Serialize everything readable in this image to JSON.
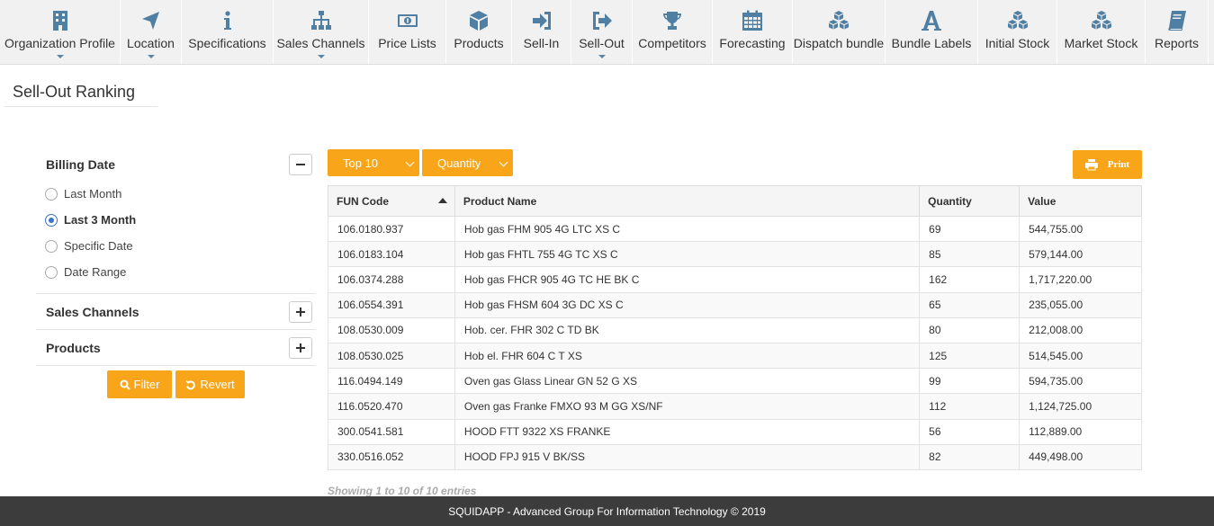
{
  "nav": {
    "items": [
      {
        "label": "Organization Profile",
        "icon": "building-icon",
        "has_dropdown": true
      },
      {
        "label": "Location",
        "icon": "location-arrow-icon",
        "has_dropdown": true
      },
      {
        "label": "Specifications",
        "icon": "info-icon",
        "has_dropdown": false
      },
      {
        "label": "Sales Channels",
        "icon": "sitemap-icon",
        "has_dropdown": true
      },
      {
        "label": "Price Lists",
        "icon": "money-icon",
        "has_dropdown": false
      },
      {
        "label": "Products",
        "icon": "cube-icon",
        "has_dropdown": false
      },
      {
        "label": "Sell-In",
        "icon": "sign-in-icon",
        "has_dropdown": false
      },
      {
        "label": "Sell-Out",
        "icon": "sign-out-icon",
        "has_dropdown": true
      },
      {
        "label": "Competitors",
        "icon": "trophy-icon",
        "has_dropdown": false
      },
      {
        "label": "Forecasting",
        "icon": "calendar-icon",
        "has_dropdown": false
      },
      {
        "label": "Dispatch bundle",
        "icon": "cubes-icon",
        "has_dropdown": false
      },
      {
        "label": "Bundle Labels",
        "icon": "font-icon",
        "has_dropdown": false
      },
      {
        "label": "Initial Stock",
        "icon": "cubes-icon",
        "has_dropdown": false
      },
      {
        "label": "Market Stock",
        "icon": "cubes-icon",
        "has_dropdown": false
      },
      {
        "label": "Reports",
        "icon": "book-icon",
        "has_dropdown": false
      }
    ]
  },
  "page": {
    "title": "Sell-Out Ranking"
  },
  "filters": {
    "billing_date": {
      "title": "Billing Date",
      "options": [
        "Last Month",
        "Last 3 Month",
        "Specific Date",
        "Date Range"
      ],
      "selected": "Last 3 Month"
    },
    "sales_channels": {
      "title": "Sales Channels"
    },
    "products": {
      "title": "Products"
    },
    "filter_label": "Filter",
    "revert_label": "Revert"
  },
  "toolbar": {
    "top_selected": "Top 10",
    "metric_selected": "Quantity",
    "print_label": "Print"
  },
  "table": {
    "columns": [
      "FUN Code",
      "Product Name",
      "Quantity",
      "Value"
    ],
    "sort_column": "FUN Code",
    "rows": [
      [
        "106.0180.937",
        "Hob gas FHM 905 4G LTC XS C",
        "69",
        "544,755.00"
      ],
      [
        "106.0183.104",
        "Hob gas FHTL 755 4G TC XS C",
        "85",
        "579,144.00"
      ],
      [
        "106.0374.288",
        "Hob gas FHCR 905 4G TC HE BK C",
        "162",
        "1,717,220.00"
      ],
      [
        "106.0554.391",
        "Hob gas FHSM 604 3G DC XS C",
        "65",
        "235,055.00"
      ],
      [
        "108.0530.009",
        "Hob. cer. FHR 302 C TD BK",
        "80",
        "212,008.00"
      ],
      [
        "108.0530.025",
        "Hob el. FHR 604 C T XS",
        "125",
        "514,545.00"
      ],
      [
        "116.0494.149",
        "Oven gas Glass Linear GN 52 G XS",
        "99",
        "594,735.00"
      ],
      [
        "116.0520.470",
        "Oven gas Franke FMXO 93 M GG XS/NF",
        "112",
        "1,124,725.00"
      ],
      [
        "300.0541.581",
        "HOOD FTT 9322 XS FRANKE",
        "56",
        "112,889.00"
      ],
      [
        "330.0516.052",
        "HOOD FPJ 915 V BK/SS",
        "82",
        "449,498.00"
      ]
    ]
  },
  "showing_text": "Showing 1 to 10 of 10 entries",
  "footer_text": "SQUIDAPP - Advanced Group For Information Technology © 2019",
  "colors": {
    "accent": "#f9a51a",
    "nav_icon": "#4f7fa3",
    "footer_bg": "#3c3c3c"
  }
}
